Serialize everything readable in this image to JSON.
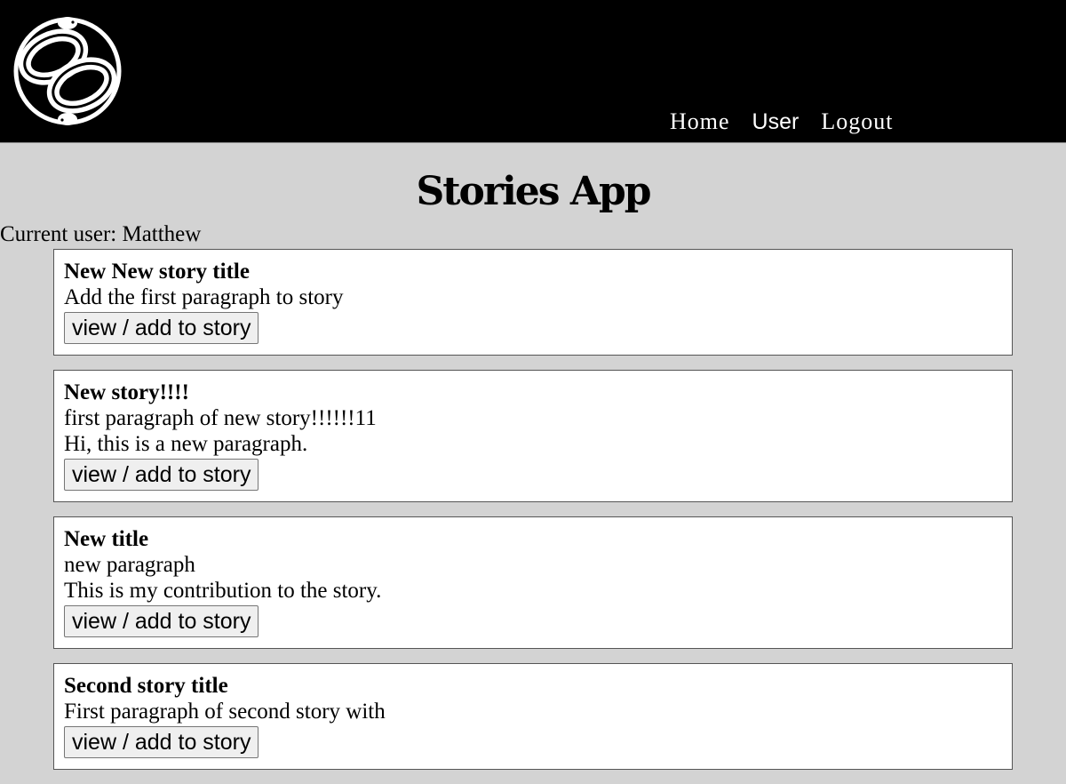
{
  "header": {
    "logo_icon": "auryn-snakes-logo-icon",
    "nav": [
      {
        "label": "Home"
      },
      {
        "label": "User"
      },
      {
        "label": "Logout"
      }
    ]
  },
  "app_title": "Stories App",
  "current_user_label": "Current user: Matthew",
  "stories": [
    {
      "title": "New New story title",
      "paragraphs": [
        "Add the first paragraph to story"
      ],
      "button": "view / add to story"
    },
    {
      "title": "New story!!!!",
      "paragraphs": [
        "first paragraph of new story!!!!!!11",
        "Hi, this is a new paragraph."
      ],
      "button": "view / add to story"
    },
    {
      "title": "New title",
      "paragraphs": [
        "new paragraph",
        "This is my contribution to the story."
      ],
      "button": "view / add to story"
    },
    {
      "title": "Second story title",
      "paragraphs": [
        "First paragraph of second story with"
      ],
      "button": "view / add to story"
    }
  ]
}
